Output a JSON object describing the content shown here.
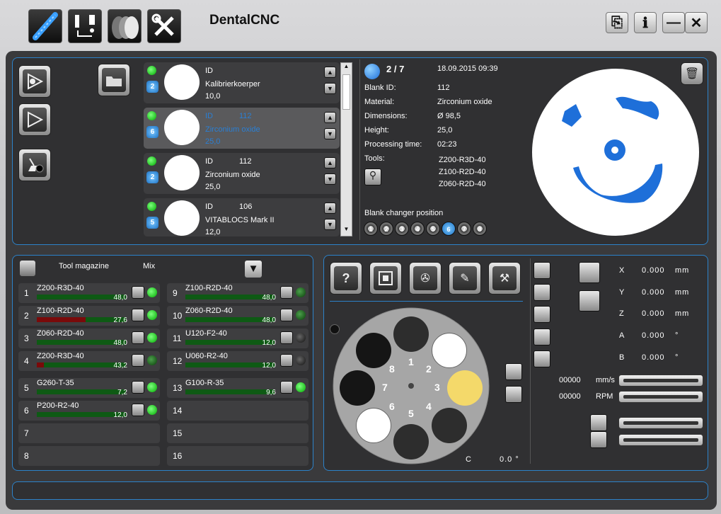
{
  "app": {
    "title": "DentalCNC"
  },
  "toolbar": {
    "icons": [
      "tool-bar-icon",
      "machine-calibration-icon",
      "blank-disc-icon",
      "settings-tools-icon"
    ]
  },
  "window_buttons": [
    "exit-icon",
    "info-icon",
    "minimize-icon",
    "close-icon"
  ],
  "jobs": [
    {
      "id_label": "ID",
      "id": "",
      "material": "Kalibrierkoerper",
      "height": "10,0",
      "slot": "2",
      "selected": false
    },
    {
      "id_label": "ID",
      "id": "112",
      "material": "Zirconium oxide",
      "height": "25,0",
      "slot": "6",
      "selected": true
    },
    {
      "id_label": "ID",
      "id": "112",
      "material": "Zirconium oxide",
      "height": "25,0",
      "slot": "2",
      "selected": false
    },
    {
      "id_label": "ID",
      "id": "106",
      "material": "VITABLOCS Mark II",
      "height": "12,0",
      "slot": "5",
      "selected": false
    }
  ],
  "details": {
    "counter": "2 / 7",
    "datetime": "18.09.2015 09:39",
    "rows": [
      {
        "label": "Blank ID:",
        "value": "112"
      },
      {
        "label": "Material:",
        "value": "Zirconium oxide"
      },
      {
        "label": "Dimensions:",
        "value": "Ø 98,5"
      },
      {
        "label": "Height:",
        "value": "25,0"
      },
      {
        "label": "Processing time:",
        "value": "02:23"
      }
    ],
    "tools_label": "Tools:",
    "tools": [
      "Z200-R3D-40",
      "Z100-R2D-40",
      "Z060-R2D-40"
    ],
    "changer_label": "Blank changer position",
    "changer_positions": [
      "1",
      "2",
      "3",
      "4",
      "5",
      "6",
      "7",
      "8"
    ],
    "changer_active": "6"
  },
  "magazine": {
    "title": "Tool magazine",
    "mix": "Mix",
    "left": [
      {
        "n": "1",
        "name": "Z200-R3D-40",
        "value": "48,0",
        "wear": 0,
        "led": "on"
      },
      {
        "n": "2",
        "name": "Z100-R2D-40",
        "value": "27,6",
        "wear": 0.55,
        "led": "on"
      },
      {
        "n": "3",
        "name": "Z060-R2D-40",
        "value": "48,0",
        "wear": 0,
        "led": "on"
      },
      {
        "n": "4",
        "name": "Z200-R3D-40",
        "value": "43,2",
        "wear": 0.08,
        "led": "dim"
      },
      {
        "n": "5",
        "name": "G260-T-35",
        "value": "7,2",
        "wear": 0,
        "led": "on"
      },
      {
        "n": "6",
        "name": "P200-R2-40",
        "value": "12,0",
        "wear": 0,
        "led": "on"
      },
      {
        "n": "7",
        "name": "",
        "value": "",
        "wear": 0,
        "led": ""
      },
      {
        "n": "8",
        "name": "",
        "value": "",
        "wear": 0,
        "led": ""
      }
    ],
    "right": [
      {
        "n": "9",
        "name": "Z100-R2D-40",
        "value": "48,0",
        "wear": 0,
        "led": "dim"
      },
      {
        "n": "10",
        "name": "Z060-R2D-40",
        "value": "48,0",
        "wear": 0,
        "led": "dim"
      },
      {
        "n": "11",
        "name": "U120-F2-40",
        "value": "12,0",
        "wear": 0,
        "led": "off"
      },
      {
        "n": "12",
        "name": "U060-R2-40",
        "value": "12,0",
        "wear": 0,
        "led": "off"
      },
      {
        "n": "13",
        "name": "G100-R-35",
        "value": "9,6",
        "wear": 0,
        "led": "on"
      },
      {
        "n": "14",
        "name": "",
        "value": "",
        "wear": 0,
        "led": ""
      },
      {
        "n": "15",
        "name": "",
        "value": "",
        "wear": 0,
        "led": ""
      },
      {
        "n": "16",
        "name": "",
        "value": "",
        "wear": 0,
        "led": ""
      }
    ]
  },
  "machine": {
    "carousel_numbers": [
      "1",
      "2",
      "3",
      "4",
      "5",
      "6",
      "7",
      "8"
    ],
    "c_label": "C",
    "c_value": "0.0 °",
    "axes": [
      {
        "name": "X",
        "value": "0.000",
        "unit": "mm"
      },
      {
        "name": "Y",
        "value": "0.000",
        "unit": "mm"
      },
      {
        "name": "Z",
        "value": "0.000",
        "unit": "mm"
      },
      {
        "name": "A",
        "value": "0.000",
        "unit": "°"
      },
      {
        "name": "B",
        "value": "0.000",
        "unit": "°"
      }
    ],
    "feed": {
      "value": "00000",
      "unit": "mm/s"
    },
    "spindle": {
      "value": "00000",
      "unit": "RPM"
    }
  },
  "colors": {
    "accent": "#2c82c9",
    "led_on": "#00cc00",
    "blue_part": "#1e6fd9",
    "wear_red": "#7a0a0a"
  }
}
